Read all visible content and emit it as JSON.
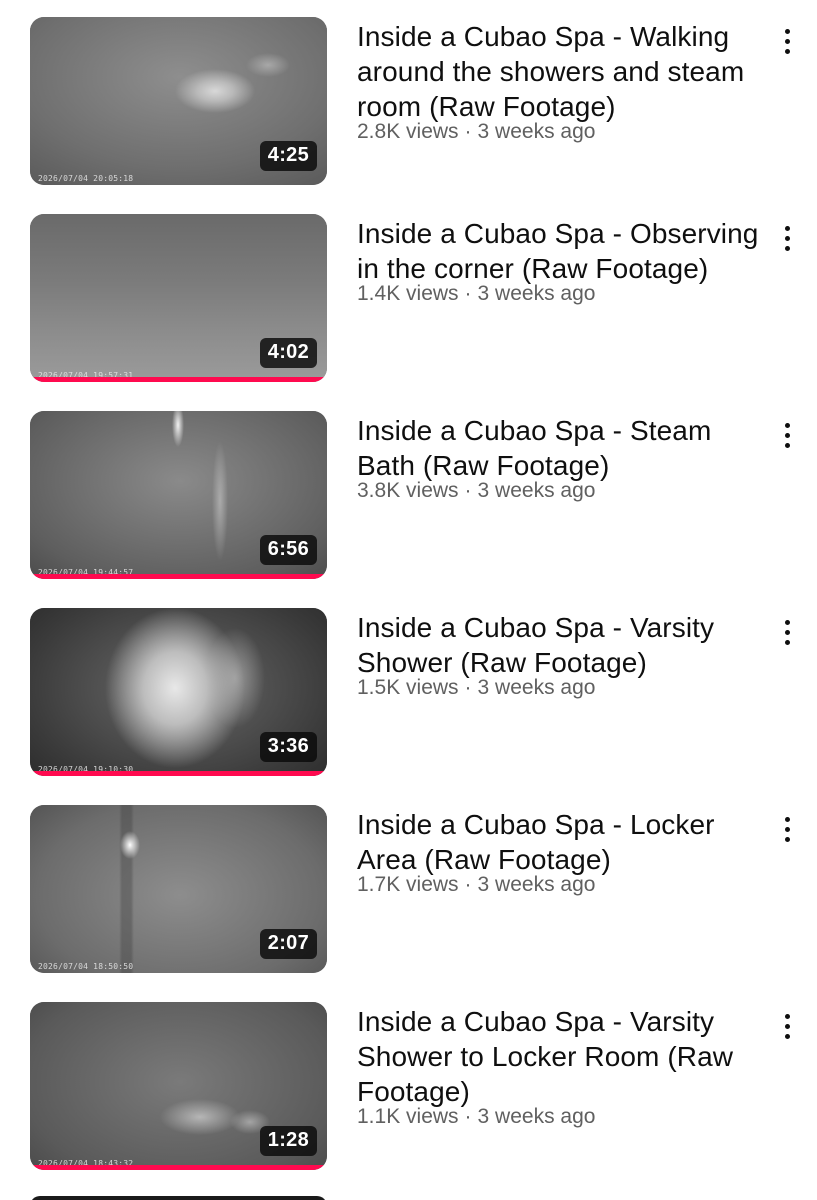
{
  "videos": [
    {
      "title": "Inside a Cubao Spa - Walking around the showers and steam room (Raw Footage)",
      "views": "2.8K views",
      "age": "3 weeks ago",
      "duration": "4:25",
      "timestamp": "2026/07/04  20:05:18",
      "watched": 0
    },
    {
      "title": "Inside a Cubao Spa - Observing in the corner (Raw Footage)",
      "views": "1.4K views",
      "age": "3 weeks ago",
      "duration": "4:02",
      "timestamp": "2026/07/04  19:57:31",
      "watched": 1
    },
    {
      "title": "Inside a Cubao Spa - Steam Bath (Raw Footage)",
      "views": "3.8K views",
      "age": "3 weeks ago",
      "duration": "6:56",
      "timestamp": "2026/07/04  19:44:57",
      "watched": 1
    },
    {
      "title": "Inside a Cubao Spa - Varsity Shower (Raw Footage)",
      "views": "1.5K views",
      "age": "3 weeks ago",
      "duration": "3:36",
      "timestamp": "2026/07/04  19:10:30",
      "watched": 1
    },
    {
      "title": "Inside a Cubao Spa - Locker Area (Raw Footage)",
      "views": "1.7K views",
      "age": "3 weeks ago",
      "duration": "2:07",
      "timestamp": "2026/07/04  18:50:50",
      "watched": 0
    },
    {
      "title": "Inside a Cubao Spa - Varsity Shower to Locker Room (Raw Footage)",
      "views": "1.1K views",
      "age": "3 weeks ago",
      "duration": "1:28",
      "timestamp": "2026/07/04  18:43:32",
      "watched": 1
    }
  ],
  "separator": "·",
  "icons": {
    "more": "more-vert-icon"
  },
  "colors": {
    "progress": "#ff0a4f",
    "title": "#0f0f0f",
    "meta": "#606060"
  }
}
